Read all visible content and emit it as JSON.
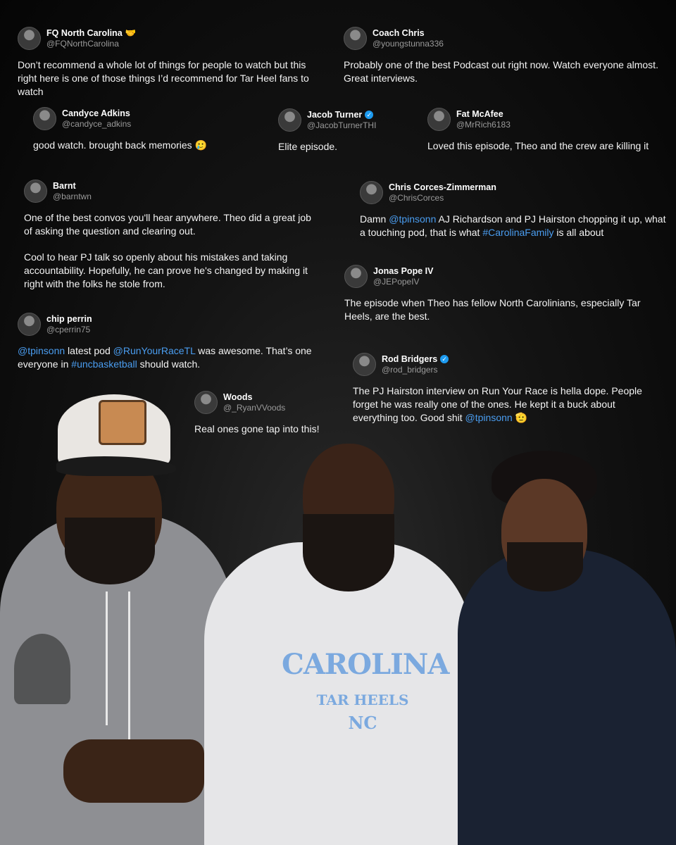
{
  "tweets": [
    {
      "name": "FQ North Carolina",
      "handle": "@FQNorthCarolina",
      "verified": false,
      "badge": "🤝",
      "text": "Don’t recommend a whole lot of things for people to watch but this right here is one of those things I’d recommend for Tar Heel fans to watch"
    },
    {
      "name": "Coach Chris",
      "handle": "@youngstunna336",
      "verified": false,
      "text": "Probably one of the best Podcast out right now. Watch everyone almost. Great interviews."
    },
    {
      "name": "Candyce Adkins",
      "handle": "@candyce_adkins",
      "verified": false,
      "text": "good watch. brought back memories",
      "emoji": "🥲"
    },
    {
      "name": "Jacob Turner",
      "handle": "@JacobTurnerTHI",
      "verified": true,
      "text": "Elite episode."
    },
    {
      "name": "Fat McAfee",
      "handle": "@MrRich6183",
      "verified": false,
      "text": "Loved this episode, Theo and the crew are killing it"
    },
    {
      "name": "Barnt",
      "handle": "@barntwn",
      "verified": false,
      "paragraph1": "One of the best convos you'll hear anywhere. Theo did a great job of asking the question and clearing out.",
      "paragraph2": "Cool to hear PJ talk so openly about his mistakes and taking accountability. Hopefully, he can prove he's changed by making it right with the folks he stole from."
    },
    {
      "name": "Chris Corces-Zimmerman",
      "handle": "@ChrisCorces",
      "verified": false,
      "t1": "Damn ",
      "link1": "@tpinsonn",
      "t2": " AJ Richardson and PJ Hairston chopping it up, what a touching pod, that is what ",
      "link2": "#CarolinaFamily",
      "t3": " is all about"
    },
    {
      "name": "Jonas Pope IV",
      "handle": "@JEPopeIV",
      "verified": false,
      "text": "The episode when Theo has fellow North Carolinians, especially Tar Heels, are the best."
    },
    {
      "name": "chip perrin",
      "handle": "@cperrin75",
      "verified": false,
      "link1": "@tpinsonn",
      "t1": " latest pod ",
      "link2": "@RunYourRaceTL",
      "t2": " was awesome.  That’s one everyone in ",
      "link3": "#uncbasketball",
      "t3": " should watch."
    },
    {
      "name": "Rod Bridgers",
      "handle": "@rod_bridgers",
      "verified": true,
      "t1": "The PJ Hairston interview on Run Your Race is hella dope. People forget he was really one of the ones. He kept it a buck about everything too. Good shit ",
      "link1": "@tpinsonn",
      "emoji": "🫡"
    },
    {
      "name": "Woods",
      "handle": "@_RyanVVoods",
      "verified": false,
      "text": "Real ones gone tap into this!"
    }
  ],
  "hoodie_logo": {
    "line1": "CAROLINA",
    "line2": "TAR HEELS",
    "monogram": "NC"
  },
  "colors": {
    "link": "#4a9df0",
    "verified": "#1d9bf0",
    "logo": "#7ba9df"
  }
}
